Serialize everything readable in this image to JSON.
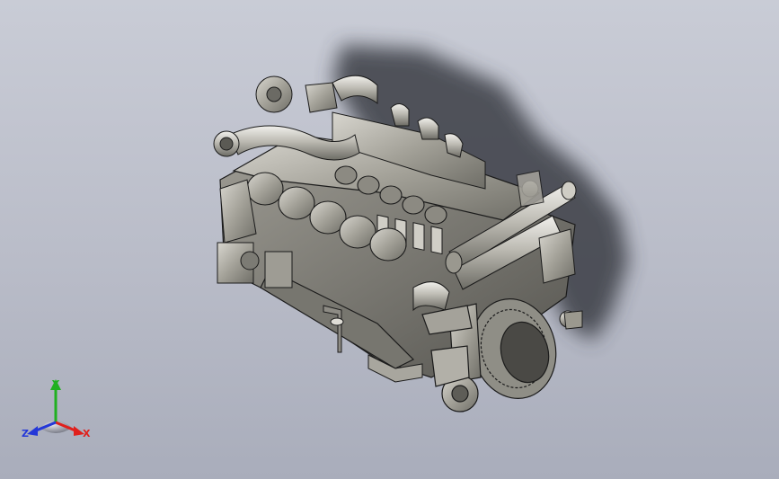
{
  "viewport": {
    "background_top": "#c9ccd6",
    "background_bottom": "#a9adbb"
  },
  "model": {
    "icon": "engine-3d-model",
    "shade_color": "#8f8e86",
    "outline_color": "#1b1b1b",
    "shadow_color": "#3a3c44"
  },
  "triad": {
    "x_label": "X",
    "y_label": "Y",
    "z_label": "Z",
    "x_color": "#e0201c",
    "y_color": "#20b020",
    "z_color": "#2438d8"
  }
}
